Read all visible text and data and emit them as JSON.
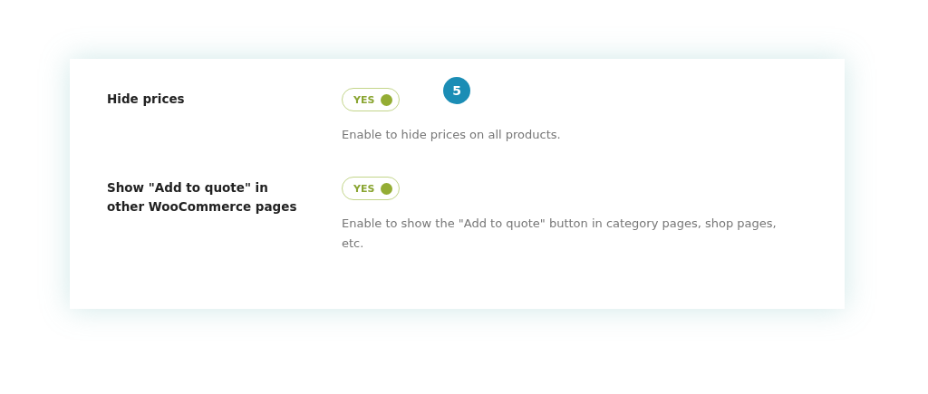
{
  "badge": "5",
  "settings": [
    {
      "label": "Hide prices",
      "toggle": {
        "on": true,
        "text": "YES"
      },
      "description": "Enable to hide prices on all products."
    },
    {
      "label": "Show \"Add to quote\" in other WooCommerce pages",
      "toggle": {
        "on": true,
        "text": "YES"
      },
      "description": "Enable to show the \"Add to quote\" button in category pages, shop pages, etc."
    }
  ]
}
